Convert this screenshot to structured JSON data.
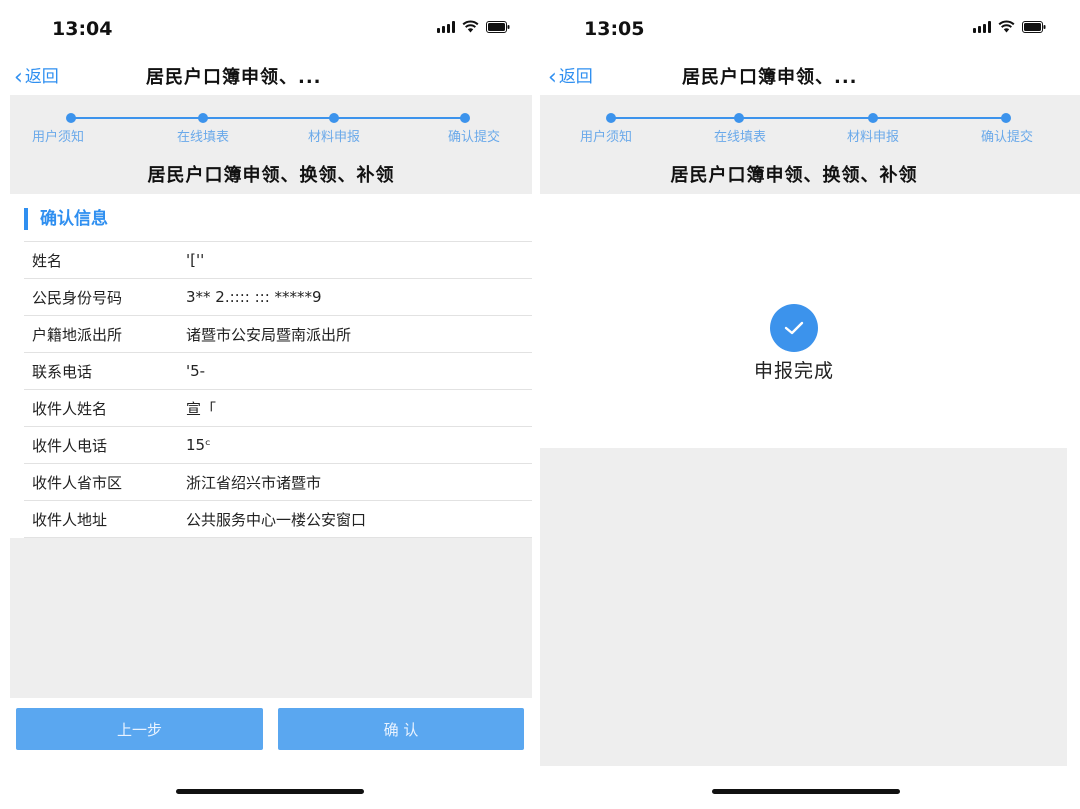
{
  "left": {
    "status": {
      "time": "13:04"
    },
    "nav": {
      "back_label": "返回",
      "title": "居民户口簿申领、..."
    },
    "steps": [
      "用户须知",
      "在线填表",
      "材料申报",
      "确认提交"
    ],
    "form_title": "居民户口簿申领、换领、补领",
    "section_title": "确认信息",
    "rows": [
      {
        "label": "姓名",
        "value": "'[''"
      },
      {
        "label": "公民身份号码",
        "value": "3** 2.:::: ::: *****9"
      },
      {
        "label": "户籍地派出所",
        "value": "诸暨市公安局暨南派出所"
      },
      {
        "label": "联系电话",
        "value": "'5-"
      },
      {
        "label": "收件人姓名",
        "value": "宣「"
      },
      {
        "label": "收件人电话",
        "value": "15ᶜ"
      },
      {
        "label": "收件人省市区",
        "value": "浙江省绍兴市诸暨市"
      },
      {
        "label": "收件人地址",
        "value": "公共服务中心一楼公安窗口"
      }
    ],
    "buttons": {
      "prev": "上一步",
      "confirm": "确 认"
    }
  },
  "right": {
    "status": {
      "time": "13:05"
    },
    "nav": {
      "back_label": "返回",
      "title": "居民户口簿申领、..."
    },
    "steps": [
      "用户须知",
      "在线填表",
      "材料申报",
      "确认提交"
    ],
    "form_title": "居民户口簿申领、换领、补领",
    "done_text": "申报完成"
  },
  "colors": {
    "accent": "#2f8ff0",
    "panel": "#eeeeee",
    "button": "#5aa7f0"
  },
  "icons": [
    "back-chevron-icon",
    "signal-icon",
    "wifi-icon",
    "battery-icon",
    "check-icon"
  ]
}
